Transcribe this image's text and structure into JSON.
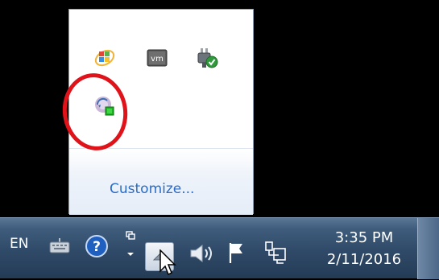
{
  "flyout": {
    "icons": [
      {
        "name": "windows-update-icon"
      },
      {
        "name": "vmware-tools-icon",
        "label": "vm"
      },
      {
        "name": "safely-remove-hardware-icon"
      },
      {
        "name": "network-share-sync-icon"
      }
    ],
    "customize_label": "Customize..."
  },
  "annotation": {
    "color": "#e0121a"
  },
  "taskbar": {
    "language": "EN",
    "time": "3:35 PM",
    "date": "2/11/2016",
    "tray_icons": [
      "keyboard-icon",
      "help-icon",
      "overflow-chevron-icon",
      "volume-icon",
      "action-center-flag-icon",
      "network-icon"
    ]
  },
  "colors": {
    "link": "#2a6bc7",
    "taskbar_top": "#5a7796",
    "taskbar_bottom": "#243b55"
  }
}
